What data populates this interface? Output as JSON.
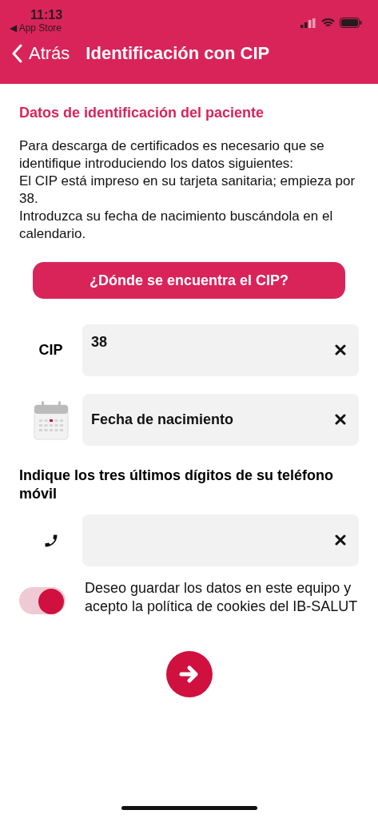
{
  "status_bar": {
    "time": "11:13",
    "back_app": "◀ App Store"
  },
  "nav": {
    "back": "Atrás",
    "title": "Identificación con CIP"
  },
  "section_title": "Datos de identificación del paciente",
  "intro": [
    "Para descarga de certificados es necesario que se identifique introduciendo los datos siguientes:",
    "El CIP está impreso en su tarjeta sanitaria; empieza por 38.",
    "Introduzca su fecha de nacimiento buscándola en el calendario."
  ],
  "help_button": "¿Dónde se encuentra el CIP?",
  "cip": {
    "label": "CIP",
    "value": "38"
  },
  "birth_date": {
    "placeholder": "Fecha de nacimiento"
  },
  "phone_prompt": "Indique los tres últimos dígitos de su teléfono móvil",
  "consent": {
    "on": true,
    "text": "Deseo guardar los datos en este equipo y acepto la política de cookies del IB-SALUT"
  }
}
